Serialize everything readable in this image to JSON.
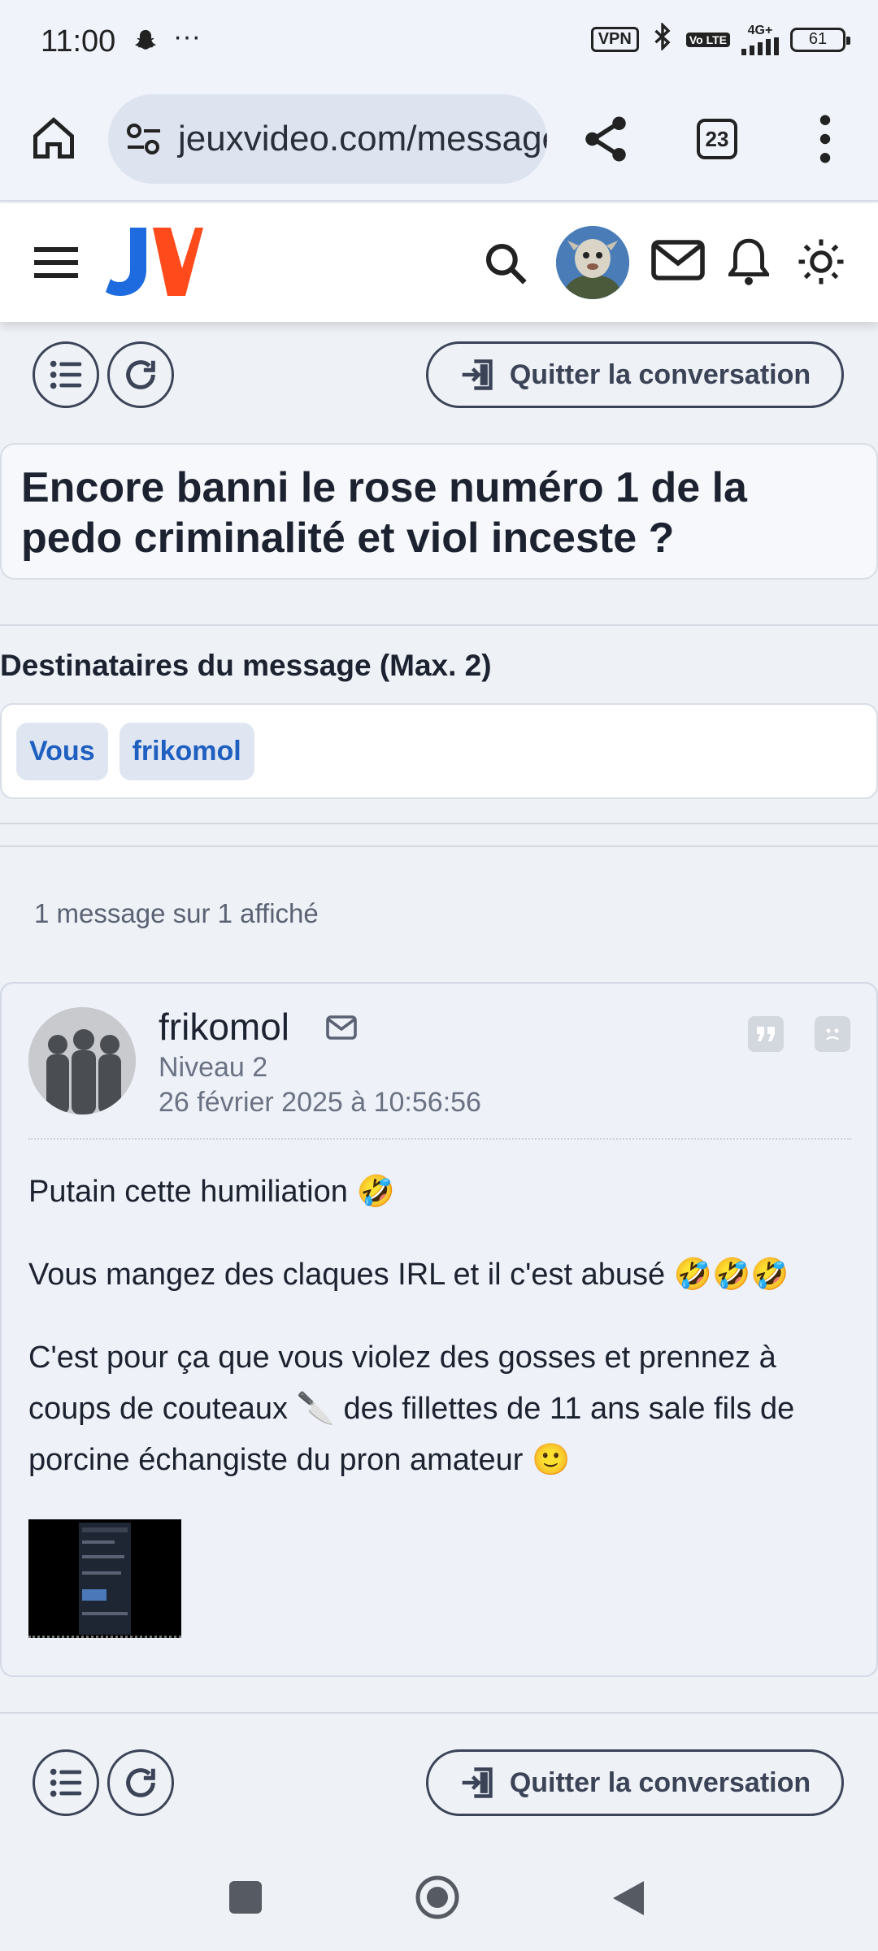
{
  "status_bar": {
    "time": "11:00",
    "dots": "···",
    "vpn": "VPN",
    "volte": "Vo LTE",
    "network": "4G+",
    "battery": "61"
  },
  "browser": {
    "url": "jeuxvideo.com/messages-prives",
    "tab_count": "23"
  },
  "header": {
    "logo": "JV"
  },
  "actions": {
    "quit_label": "Quitter la conversation"
  },
  "conversation": {
    "title": "Encore banni le rose numéro 1 de la pedo criminalité et viol inceste ?",
    "recipients_label": "Destinataires du message (Max. 2)",
    "recipients": [
      "Vous",
      "frikomol"
    ],
    "message_count": "1 message sur 1 affiché"
  },
  "message": {
    "author": "frikomol",
    "level": "Niveau 2",
    "date": "26 février 2025 à 10:56:56",
    "paragraphs": [
      "Putain cette humiliation",
      "Vous mangez des claques IRL et il c'est abusé",
      "C'est pour ça que vous violez des gosses et prennez à coups de couteaux",
      "des fillettes de 11 ans sale fils de porcine échangiste du pron amateur"
    ],
    "emojis": {
      "laugh": "🤣",
      "laugh3": "🤣🤣🤣",
      "knife": "🔪",
      "smile": "🙂"
    }
  },
  "colors": {
    "jv_blue": "#1e6be0",
    "jv_orange": "#ff4a1c",
    "chip_text": "#1e5fc0",
    "page_bg": "#eef1f6"
  }
}
